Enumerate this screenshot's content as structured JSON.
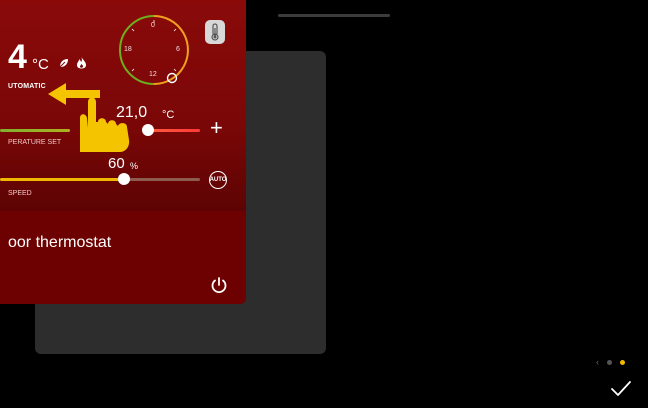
{
  "widget": {
    "current_temp": "4",
    "current_temp_unit": "°C",
    "mode_label": "UTOMATIC",
    "set_temp": "21,0",
    "set_temp_unit": "°C",
    "set_temp_label": "PERATURE SET",
    "plus_label": "+",
    "speed_value": "60",
    "speed_unit": "%",
    "speed_label": "SPEED",
    "speed_level": 0.6,
    "auto_label": "AUTO",
    "name": "oor thermostat"
  },
  "dial": {
    "labels": [
      "0",
      "6",
      "12",
      "18"
    ]
  },
  "pagination": {
    "total": 3,
    "active_index": 1
  },
  "colors": {
    "widget_bg": "#6d0000",
    "widget_top": "#8a0a0a",
    "accent": "#f0b800",
    "dial_green": "#6fae1e",
    "dial_orange": "#f0a020"
  },
  "icons": {
    "leaf": "leaf-icon",
    "flame": "flame-icon",
    "thermometer": "thermometer-icon",
    "power": "power-icon",
    "confirm": "checkmark-icon",
    "swipe": "hand-swipe-icon"
  }
}
